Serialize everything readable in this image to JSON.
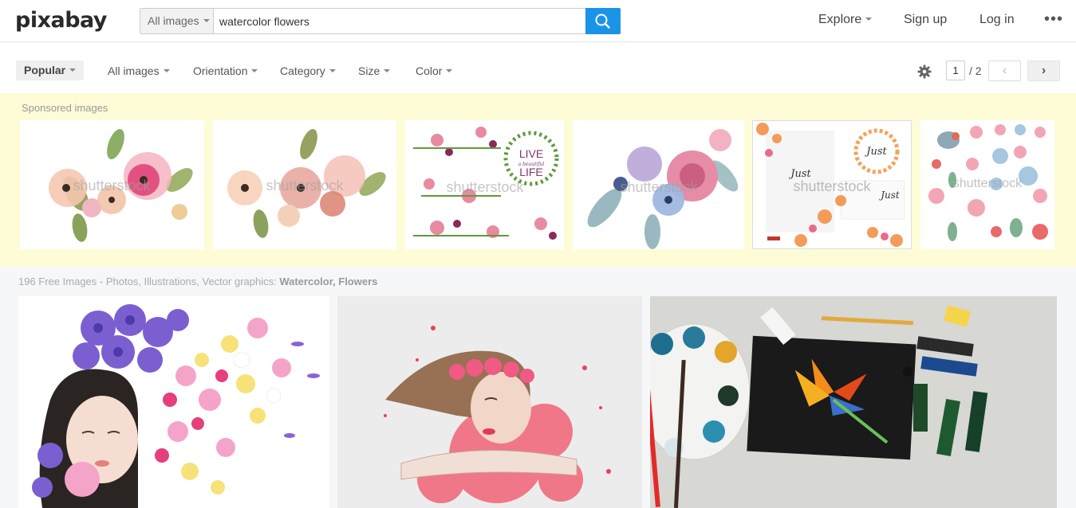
{
  "header": {
    "logo": "pixabay",
    "search": {
      "type_label": "All images",
      "value": "watercolor flowers"
    },
    "nav": {
      "explore": "Explore",
      "signup": "Sign up",
      "login": "Log in"
    },
    "accent_color": "#1a94e6"
  },
  "filters": {
    "popular": "Popular",
    "all_images": "All images",
    "orientation": "Orientation",
    "category": "Category",
    "size": "Size",
    "color": "Color",
    "page_current": "1",
    "page_total": "/ 2",
    "prev": "‹",
    "next": "›"
  },
  "sponsored": {
    "label": "Sponsored images",
    "watermark": "shutterstock",
    "live_text_1": "LIVE",
    "live_text_2": "a beautiful",
    "live_text_3": "LIFE",
    "just_text": "Just",
    "background_color": "#fdfcd7"
  },
  "results": {
    "summary_prefix": "196 Free Images - Photos, Illustrations, Vector graphics: ",
    "summary_terms": "Watercolor, Flowers"
  }
}
